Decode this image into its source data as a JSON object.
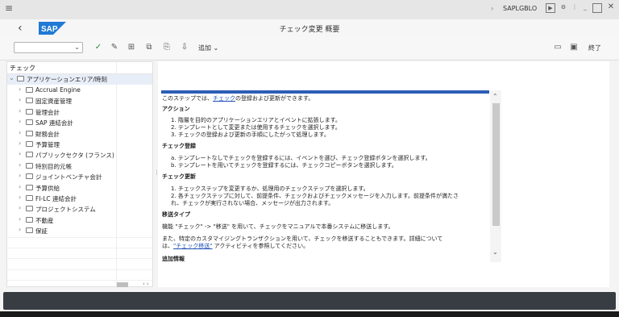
{
  "system": {
    "program": "SAPLGBLO"
  },
  "title": "チェック変更 概要",
  "toolbar": {
    "add_label": "追加",
    "end_label": "終了"
  },
  "tree": {
    "header": "チェック",
    "root": "アプリケーションエリア/時刻",
    "items": [
      "Accrual Engine",
      "固定資産管理",
      "管理会計",
      "SAP 連結会計",
      "財務会計",
      "予算管理",
      "パブリックセクタ (フランス)",
      "特別目的元帳",
      "ジョイントベンチャ会計",
      "予算供給",
      "FI-LC 連結会計",
      "プロジェクトシステム",
      "不動産",
      "保証"
    ]
  },
  "doc": {
    "intro_pre": "このステップでは、",
    "intro_link": "チェック",
    "intro_post": "の登録および更新ができます。",
    "h_action": "アクション",
    "action_items": [
      "1.  階層を目的のアプリケーションエリアとイベントに拡張します。",
      "2.  テンプレートとして変更または使用するチェックを選択します。",
      "3.  チェックの登録および更新の手順にしたがって処理します。"
    ],
    "h_register": "チェック登録",
    "register_items": [
      "a.  テンプレートなしでチェックを登録するには、イベントを選び、チェック登録ボタンを選択します。",
      "b.  テンプレートを用いてチェックを登録するには、チェックコピーボタンを選択します。"
    ],
    "h_update": "チェック更新",
    "update_items": [
      "1.  チェックステップを変更するか、処理用のチェックステップを選択します。",
      "2.  各チェックステップに対して、前提条件、チェックおよびチェックメッセージを入力します。前提条件が満たさ",
      "     れ、チェックが実行されない場合、メッセージが出力されます。"
    ],
    "h_transport": "移送タイプ",
    "transport_p1": "機能 \"チェック\" -> \"移送\" を用いて、チェックをマニュアルで本番システムに移送します。",
    "transport_p2": "また、特定のカスタマイジングトランザクションを用いて、チェックを移送することもできます。詳細について",
    "transport_p3_pre": "は、",
    "transport_p3_link": "\"チェック移送\"",
    "transport_p3_post": " アクティビティを参照してください。",
    "h_more": "追加情報"
  },
  "colors": {
    "accent": "#2b5fb5",
    "sap_blue": "#1f7ad6",
    "check_green": "#2e8b3a",
    "bottom_bar": "#383d44"
  }
}
